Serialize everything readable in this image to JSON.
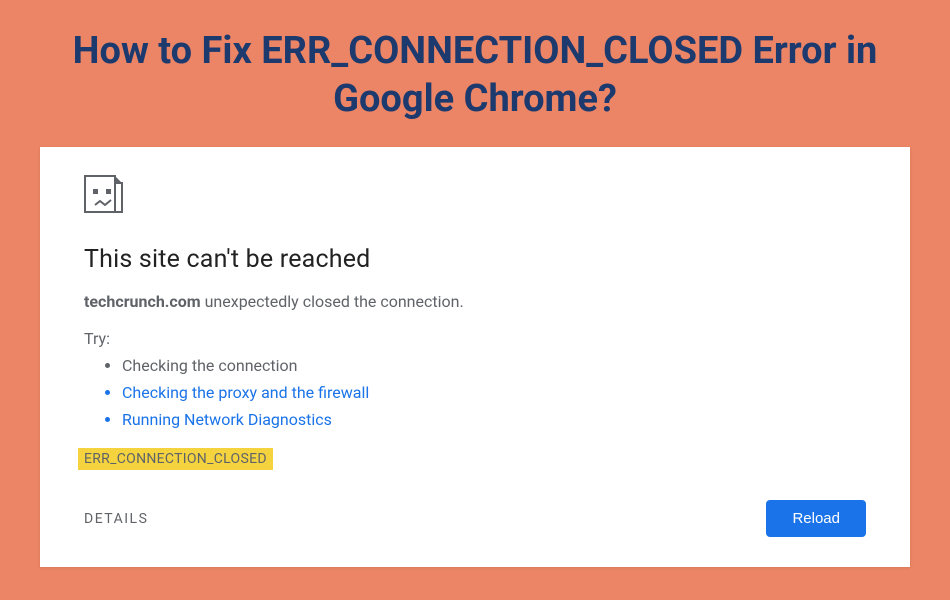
{
  "article": {
    "title": "How to Fix ERR_CONNECTION_CLOSED Error in Google Chrome?"
  },
  "error": {
    "heading": "This site can't be reached",
    "domain": "techcrunch.com",
    "message": " unexpectedly closed the connection.",
    "try_label": "Try:",
    "suggestions": [
      "Checking the connection",
      "Checking the proxy and the firewall",
      "Running Network Diagnostics"
    ],
    "code": "ERR_CONNECTION_CLOSED",
    "details_label": "DETAILS",
    "reload_label": "Reload"
  }
}
